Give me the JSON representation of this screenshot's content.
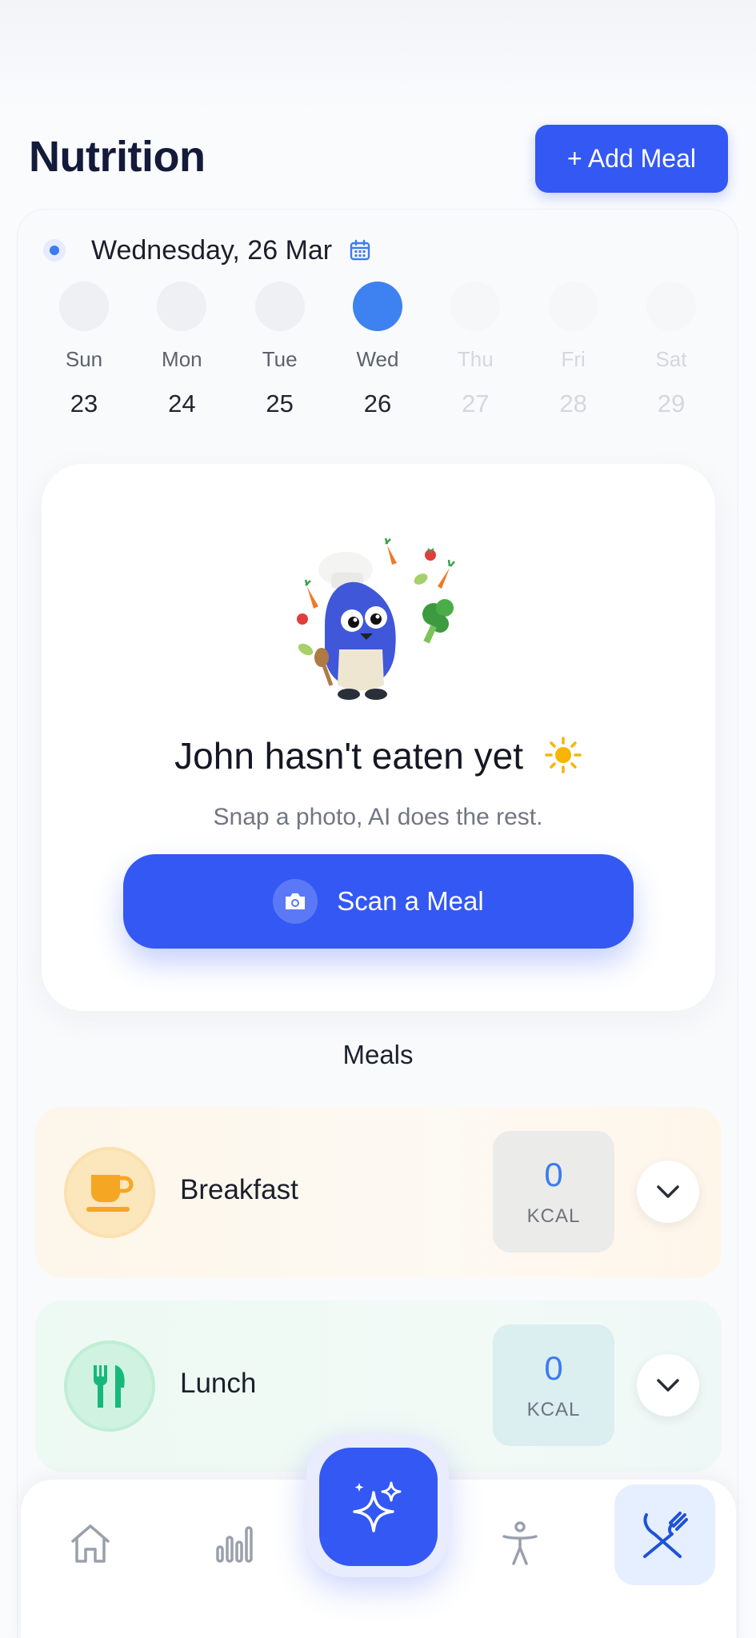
{
  "header": {
    "title": "Nutrition",
    "add_meal_label": "+ Add Meal"
  },
  "date_selector": {
    "current_date": "Wednesday, 26 Mar",
    "days": [
      {
        "name": "Sun",
        "num": "23",
        "state": "past"
      },
      {
        "name": "Mon",
        "num": "24",
        "state": "past"
      },
      {
        "name": "Tue",
        "num": "25",
        "state": "past"
      },
      {
        "name": "Wed",
        "num": "26",
        "state": "selected"
      },
      {
        "name": "Thu",
        "num": "27",
        "state": "future"
      },
      {
        "name": "Fri",
        "num": "28",
        "state": "future"
      },
      {
        "name": "Sat",
        "num": "29",
        "state": "future"
      }
    ]
  },
  "empty_state": {
    "title": "John hasn't eaten yet",
    "subtitle": "Snap a photo, AI does the rest.",
    "scan_label": "Scan a Meal",
    "mascot": "chef-mascot-illustration"
  },
  "meals": {
    "heading": "Meals",
    "items": [
      {
        "name": "Breakfast",
        "kcal": "0",
        "unit": "KCAL",
        "icon": "coffee-cup-icon",
        "accent": "#f5a623"
      },
      {
        "name": "Lunch",
        "kcal": "0",
        "unit": "KCAL",
        "icon": "fork-knife-icon",
        "accent": "#16b97a"
      }
    ]
  },
  "tabbar": {
    "tabs": [
      "home-icon",
      "bar-chart-icon",
      "sparkles-icon",
      "person-icon",
      "utensils-icon"
    ],
    "active": "utensils-icon"
  },
  "colors": {
    "primary": "#3358f4",
    "selected_day": "#3e82f1",
    "accent_blue": "#3b7cf0"
  }
}
